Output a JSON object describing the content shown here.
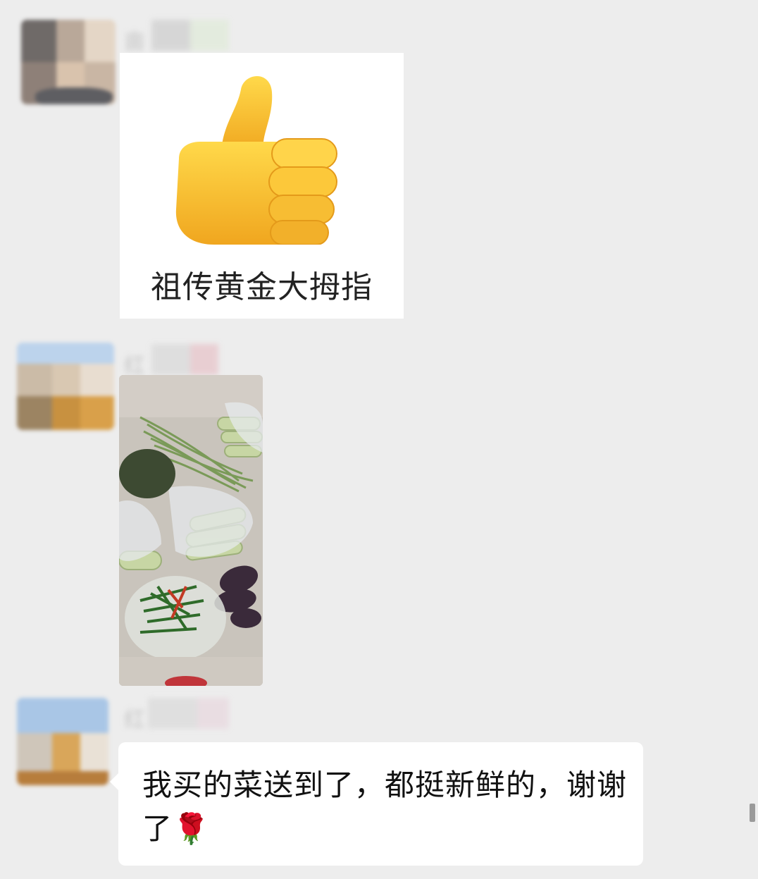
{
  "messages": [
    {
      "sender_label": "",
      "sticker": {
        "icon": "thumbs-up-icon",
        "caption": "祖传黄金大拇指"
      }
    },
    {
      "sender_label": "",
      "photo": {
        "subject": "vegetables"
      }
    },
    {
      "sender_label": "",
      "text": "我买的菜送到了，都挺新鲜的，谢谢了",
      "emoji": "🌹"
    }
  ],
  "colors": {
    "chat_background": "#ededed",
    "bubble": "#ffffff",
    "thumb_yellow": "#f6c633"
  }
}
